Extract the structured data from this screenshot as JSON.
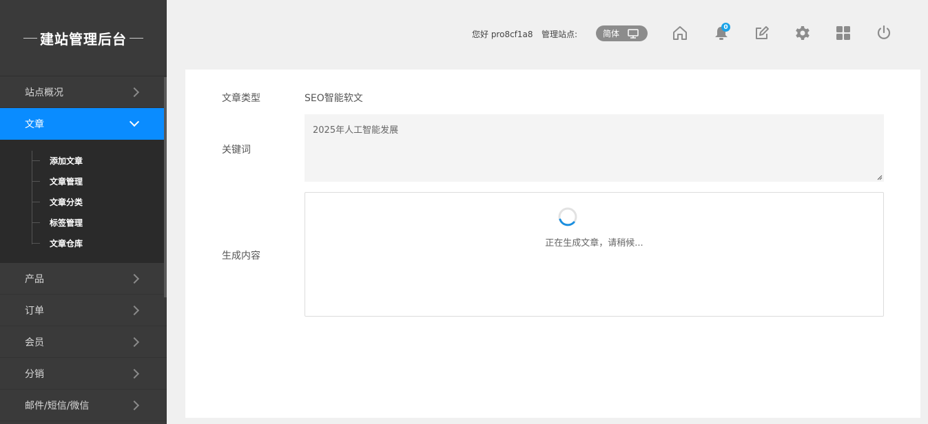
{
  "sidebar": {
    "brand": "建站管理后台",
    "items": [
      {
        "label": "站点概况"
      },
      {
        "label": "文章"
      },
      {
        "label": "产品"
      },
      {
        "label": "订单"
      },
      {
        "label": "会员"
      },
      {
        "label": "分销"
      },
      {
        "label": "邮件/短信/微信"
      }
    ],
    "article_submenu": [
      {
        "label": "添加文章"
      },
      {
        "label": "文章管理"
      },
      {
        "label": "文章分类"
      },
      {
        "label": "标签管理"
      },
      {
        "label": "文章仓库"
      }
    ],
    "accent_color": "#0a8cff"
  },
  "header": {
    "greeting": "您好 pro8cf1a8",
    "site_label": "管理站点:",
    "lang": "简体",
    "notification_count": "0",
    "icons": [
      "home-icon",
      "bell-icon",
      "edit-icon",
      "gear-icon",
      "grid-icon",
      "power-icon"
    ]
  },
  "form": {
    "type_label": "文章类型",
    "type_value": "SEO智能软文",
    "keyword_label": "关键词",
    "keyword_value": "2025年人工智能发展",
    "content_label": "生成内容",
    "loading_text": "正在生成文章，请稍候..."
  }
}
